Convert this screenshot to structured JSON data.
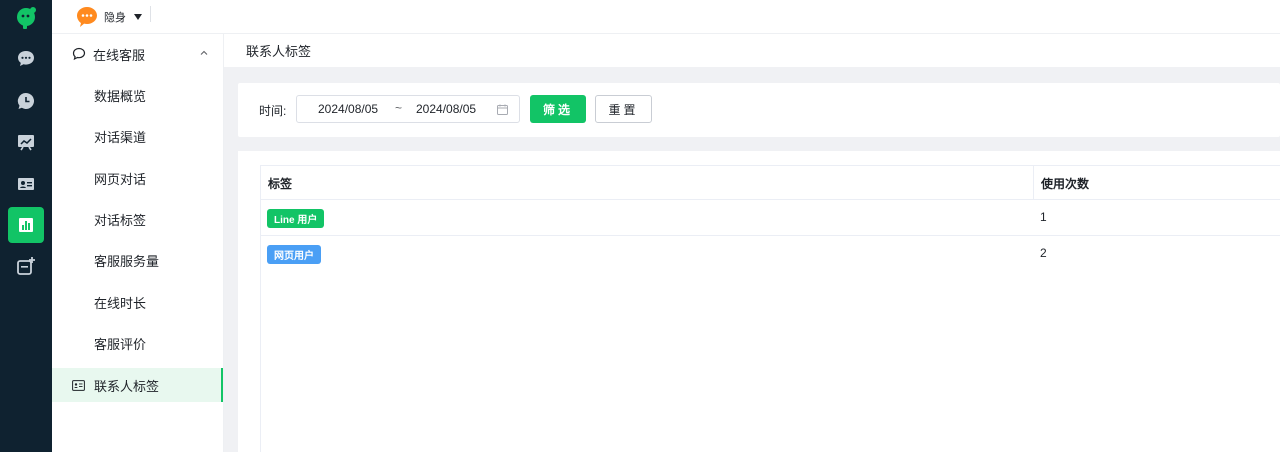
{
  "colors": {
    "accent": "#12c466",
    "rail_bg": "#0f2230",
    "tag_line": "#12c466",
    "tag_web": "#4a9ff5",
    "status_orange": "#ff8a1f"
  },
  "rail": {
    "items": [
      {
        "icon": "chat-bubble-icon"
      },
      {
        "icon": "clock-chat-icon"
      },
      {
        "icon": "chart-board-icon"
      },
      {
        "icon": "contact-card-icon"
      },
      {
        "icon": "bar-chart-icon",
        "active": true
      },
      {
        "icon": "add-app-icon"
      }
    ]
  },
  "topbar": {
    "status_label": "隐身"
  },
  "sidebar": {
    "group_title": "在线客服",
    "items": [
      {
        "label": "数据概览"
      },
      {
        "label": "对话渠道"
      },
      {
        "label": "网页对话"
      },
      {
        "label": "对话标签"
      },
      {
        "label": "客服服务量"
      },
      {
        "label": "在线时长"
      },
      {
        "label": "客服评价"
      },
      {
        "label": "联系人标签",
        "active": true
      }
    ]
  },
  "page": {
    "title": "联系人标签"
  },
  "filter": {
    "time_label": "时间:",
    "start_date": "2024/08/05",
    "separator": "~",
    "end_date": "2024/08/05",
    "filter_button": "筛选",
    "reset_button": "重置"
  },
  "table": {
    "headers": [
      "标签",
      "使用次数"
    ],
    "rows": [
      {
        "tag": "Line 用户",
        "tag_color": "#12c466",
        "count": "1"
      },
      {
        "tag": "网页用户",
        "tag_color": "#4a9ff5",
        "count": "2"
      }
    ]
  }
}
